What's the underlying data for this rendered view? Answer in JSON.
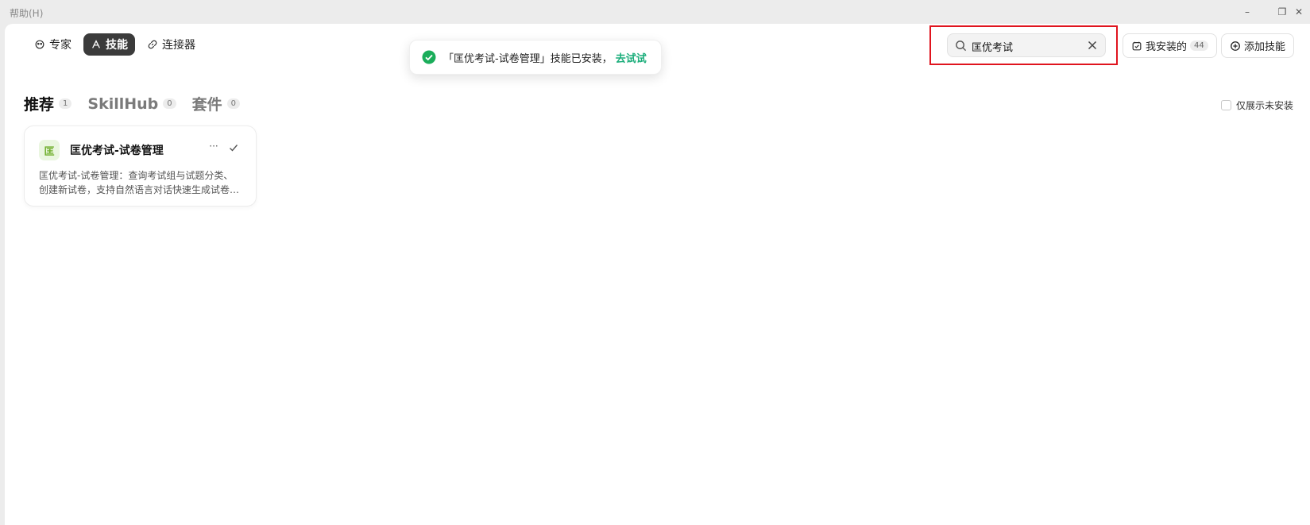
{
  "menu": {
    "help": "帮助(H)"
  },
  "window_controls": {
    "minimize": "–",
    "restore": "❐",
    "close": "✕"
  },
  "nav": {
    "tabs": [
      {
        "label": "专家",
        "icon": "expert-icon",
        "active": false
      },
      {
        "label": "技能",
        "icon": "skill-icon",
        "active": true
      },
      {
        "label": "连接器",
        "icon": "link-icon",
        "active": false
      }
    ]
  },
  "toast": {
    "message": "「匡优考试-试卷管理」技能已安装，",
    "action": "去试试",
    "status_color": "#1aad5a"
  },
  "search": {
    "value": "匡优考试",
    "placeholder": ""
  },
  "installed": {
    "label": "我安装的",
    "count": "44"
  },
  "add_skill": {
    "label": "添加技能"
  },
  "categories": [
    {
      "label": "推荐",
      "count": "1",
      "active": true
    },
    {
      "label": "SkillHub",
      "count": "0",
      "active": false
    },
    {
      "label": "套件",
      "count": "0",
      "active": false
    }
  ],
  "filter": {
    "label": "仅展示未安装",
    "checked": false
  },
  "cards": [
    {
      "icon_text": "匡",
      "title": "匡优考试-试卷管理",
      "more": "···",
      "description": "匡优考试-试卷管理：查询考试组与试题分类、创建新试卷，支持自然语言对话快速生成试卷。当前支持..."
    }
  ],
  "colors": {
    "accent": "#1aad7a",
    "highlight": "#e0141e",
    "active_tab": "#3b3b3b"
  }
}
